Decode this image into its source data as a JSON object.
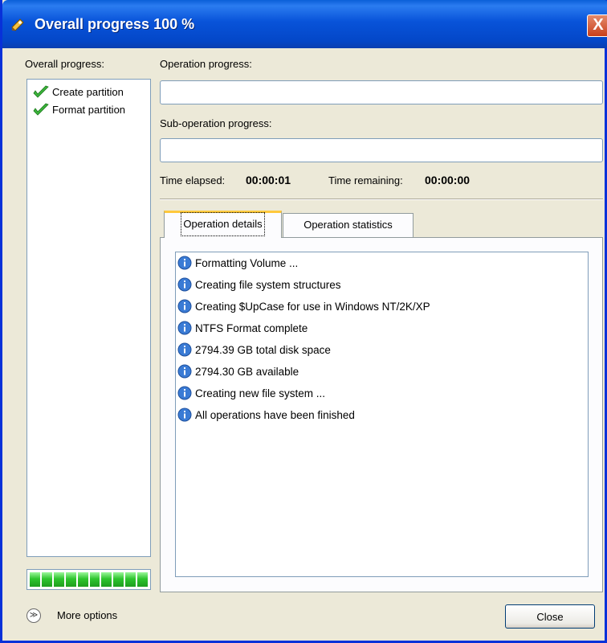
{
  "window": {
    "title": "Overall progress 100 %",
    "close_glyph": "X"
  },
  "overall": {
    "label": "Overall progress:",
    "items": [
      {
        "label": "Create partition",
        "icon": "checkmark-icon",
        "status": "done"
      },
      {
        "label": "Format partition",
        "icon": "checkmark-icon",
        "status": "done"
      }
    ],
    "progress_fraction": 1.0,
    "led_color": "#2ec52e"
  },
  "operation": {
    "label": "Operation progress:",
    "value": ""
  },
  "sub_operation": {
    "label": "Sub-operation progress:",
    "value": ""
  },
  "time": {
    "elapsed_label": "Time elapsed:",
    "elapsed_value": "00:00:01",
    "remaining_label": "Time remaining:",
    "remaining_value": "00:00:00"
  },
  "tabs": [
    {
      "label": "Operation details",
      "active": true
    },
    {
      "label": "Operation statistics",
      "active": false
    }
  ],
  "details": [
    {
      "text": "Formatting Volume ...",
      "icon": "info-icon"
    },
    {
      "text": "Creating file system structures",
      "icon": "info-icon"
    },
    {
      "text": "Creating $UpCase for use in Windows NT/2K/XP",
      "icon": "info-icon"
    },
    {
      "text": "NTFS Format complete",
      "icon": "info-icon"
    },
    {
      "text": "2794.39 GB total disk space",
      "icon": "info-icon"
    },
    {
      "text": "2794.30 GB available",
      "icon": "info-icon"
    },
    {
      "text": "Creating new file system ...",
      "icon": "info-icon"
    },
    {
      "text": "All operations have been finished",
      "icon": "info-icon"
    }
  ],
  "footer": {
    "more_options": "More options",
    "more_glyph": "≫",
    "close": "Close"
  },
  "colors": {
    "titlebar": "#0853d9",
    "dialog_bg": "#ece9d8",
    "info_icon": "#3a7bd5",
    "check": "#3cb43c"
  }
}
